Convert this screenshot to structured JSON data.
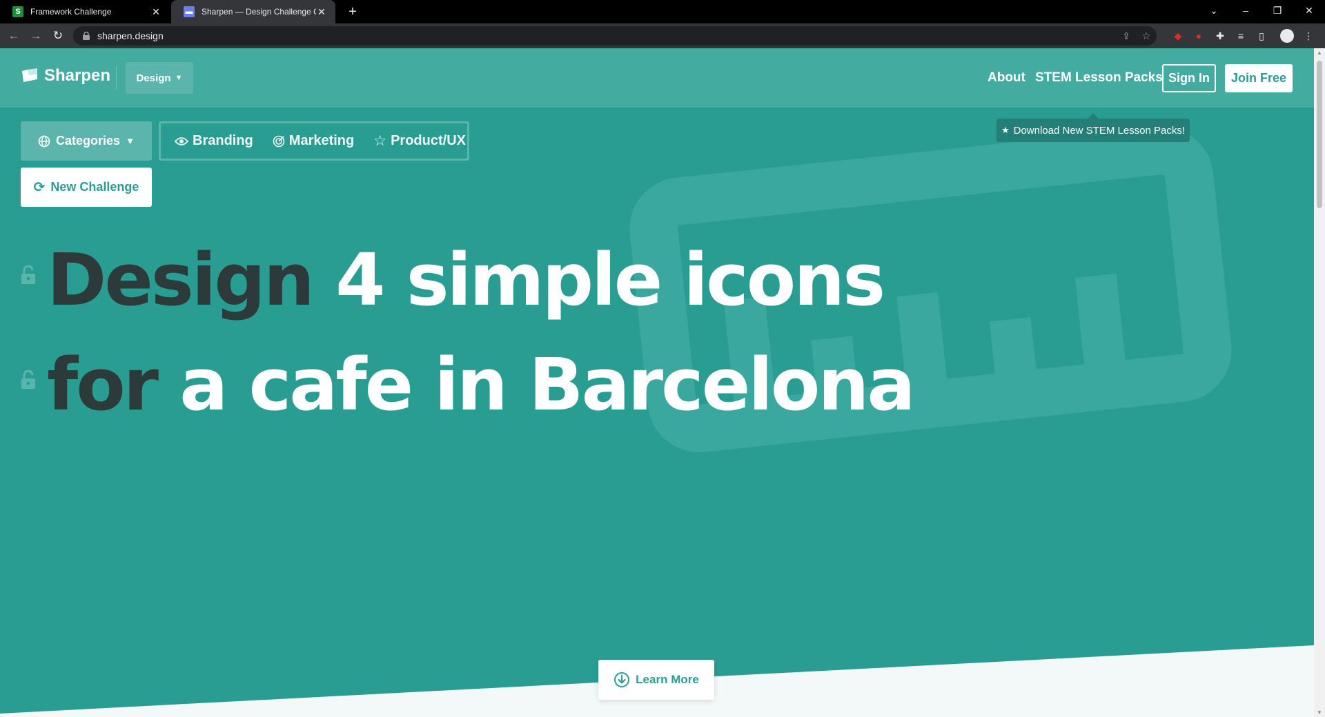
{
  "browser": {
    "tabs": [
      {
        "title": "Framework Challenge",
        "favicon": "S",
        "active": false
      },
      {
        "title": "Sharpen — Design Challenge Ge",
        "favicon": "",
        "active": true
      }
    ],
    "url": "sharpen.design"
  },
  "site": {
    "brand": "Sharpen",
    "discipline_dropdown": "Design",
    "nav": {
      "about": "About",
      "stem": "STEM Lesson Packs",
      "sign_in": "Sign In",
      "join": "Join Free"
    },
    "tooltip": "Download New STEM Lesson Packs!",
    "categories_button": "Categories",
    "filters": [
      {
        "label": "Branding",
        "icon": "eye-icon"
      },
      {
        "label": "Marketing",
        "icon": "target-icon"
      },
      {
        "label": "Product/UX",
        "icon": "star-icon"
      }
    ],
    "new_challenge": "New Challenge",
    "challenge": {
      "line1_verb": "Design",
      "line1_rest": "4 simple icons",
      "line2_prep": "for",
      "line2_rest": "a cafe in Barcelona"
    },
    "learn_more": "Learn More"
  },
  "colors": {
    "brand_teal": "#2a9d93",
    "header_teal": "#44aba1",
    "dark_text": "#2c3a3a"
  }
}
